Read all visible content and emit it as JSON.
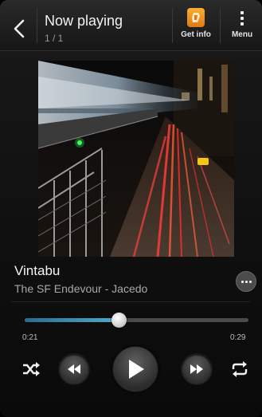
{
  "header": {
    "title": "Now playing",
    "count": "1 / 1",
    "get_info_label": "Get info",
    "menu_label": "Menu"
  },
  "track": {
    "title": "Vintabu",
    "artist_album": "The SF Endevour - Jacedo"
  },
  "progress": {
    "elapsed": "0:21",
    "duration": "0:29",
    "fraction": 0.42
  },
  "icons": {
    "back": "chevron-left-icon",
    "get_info": "get-info-icon",
    "menu": "vertical-dots-icon",
    "more": "more-options-icon",
    "shuffle": "shuffle-icon",
    "previous": "rewind-icon",
    "play": "play-icon",
    "next": "fast-forward-icon",
    "repeat": "repeat-icon"
  },
  "colors": {
    "accent_progress": "#3f93bd",
    "get_info_icon": "#f0901f",
    "background": "#111111"
  }
}
